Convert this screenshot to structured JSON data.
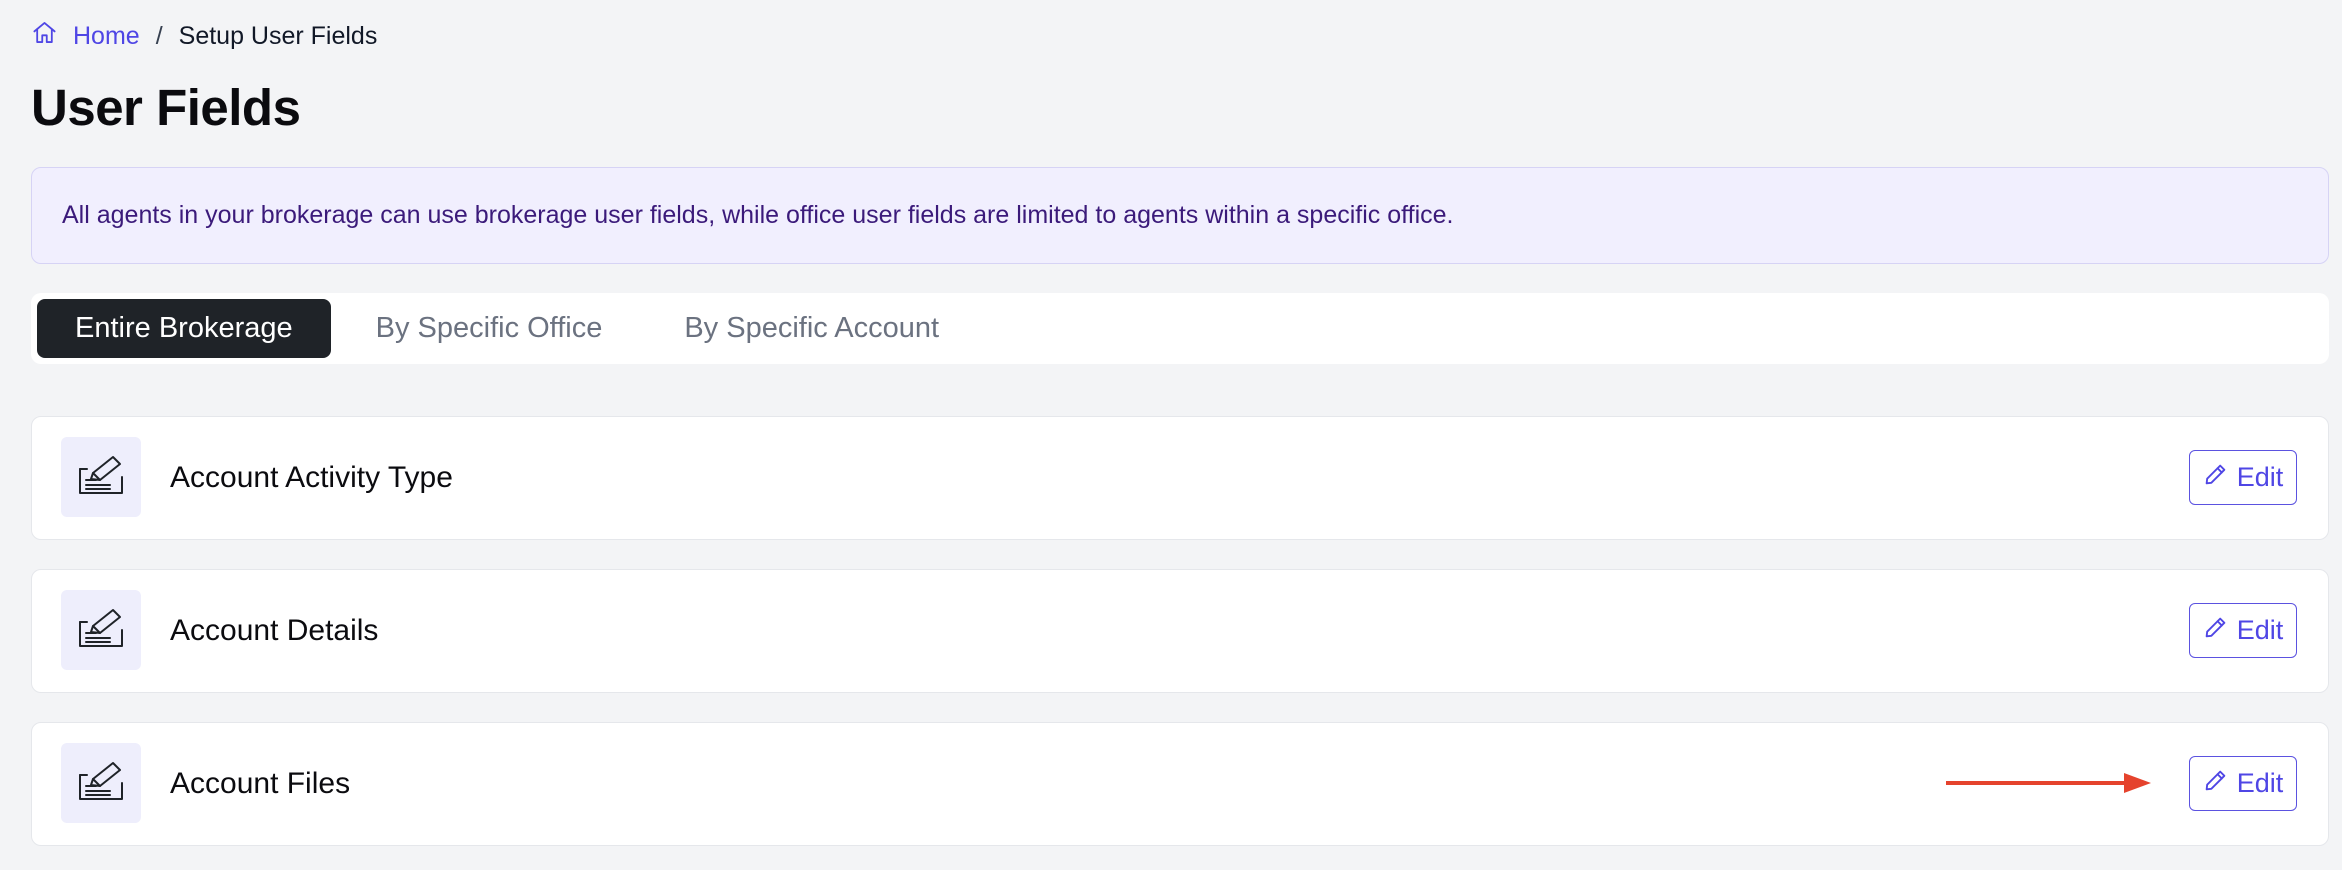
{
  "breadcrumb": {
    "home_label": "Home",
    "separator": "/",
    "current_label": "Setup User Fields"
  },
  "page_title": "User Fields",
  "info_banner": {
    "text": "All agents in your brokerage can use brokerage user fields, while office user fields are limited to agents within a specific office."
  },
  "tabs": [
    {
      "label": "Entire Brokerage",
      "active": true
    },
    {
      "label": "By Specific Office",
      "active": false
    },
    {
      "label": "By Specific Account",
      "active": false
    }
  ],
  "fields": [
    {
      "title": "Account Activity Type",
      "icon": "signature-icon",
      "edit_label": "Edit"
    },
    {
      "title": "Account Details",
      "icon": "signature-icon",
      "edit_label": "Edit"
    },
    {
      "title": "Account Files",
      "icon": "signature-icon",
      "edit_label": "Edit"
    }
  ],
  "annotation": {
    "type": "arrow",
    "color": "#e5432d",
    "points_to": "Edit button of Account Files"
  },
  "colors": {
    "accent": "#4f46e5",
    "active_tab_bg": "#1f2328",
    "banner_bg": "#f1effe",
    "banner_text": "#3b1a7a",
    "page_bg": "#f3f4f6"
  }
}
